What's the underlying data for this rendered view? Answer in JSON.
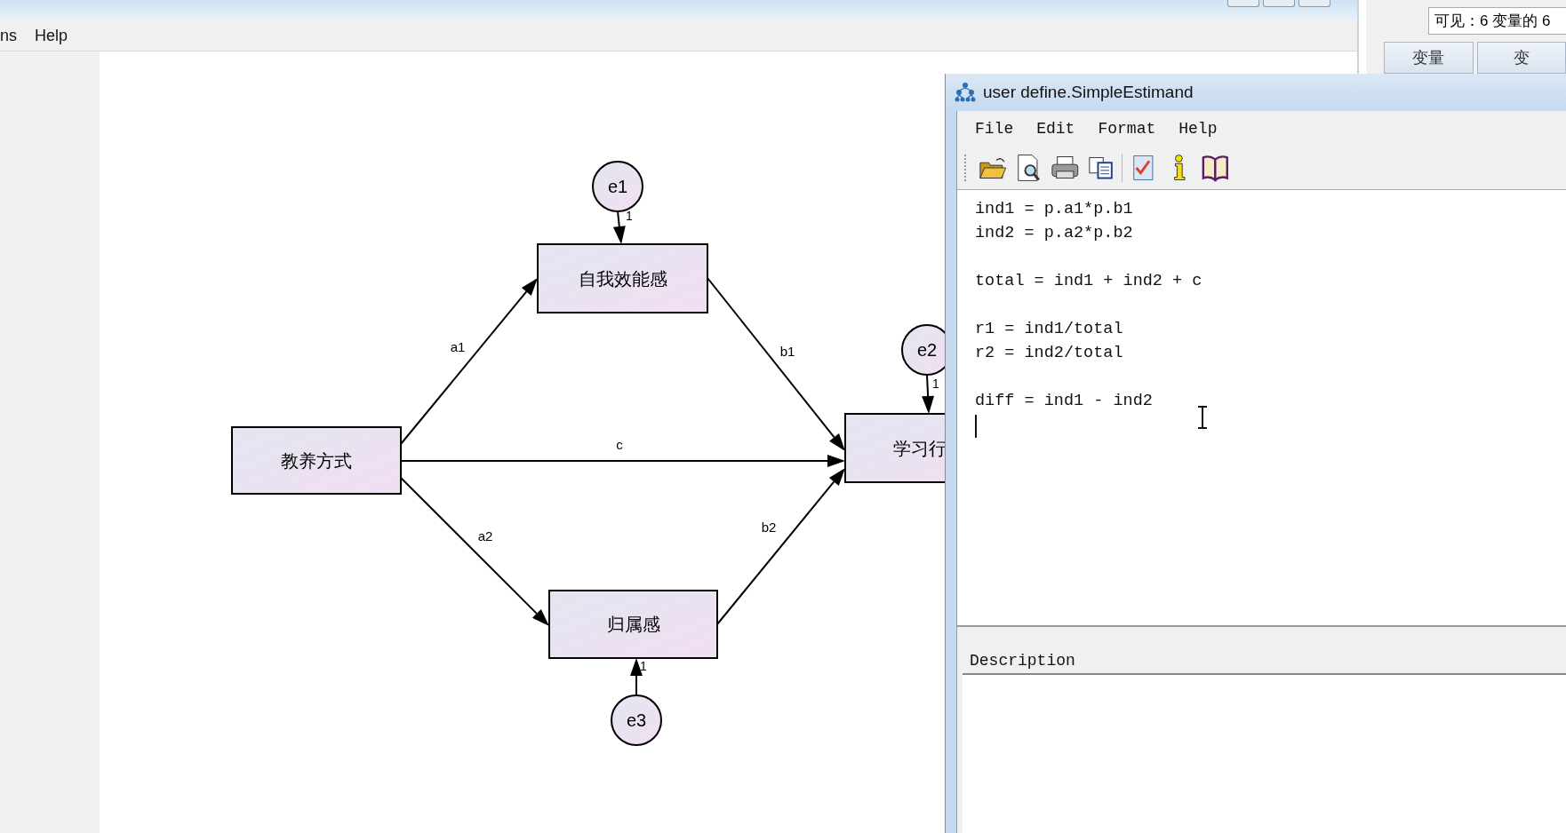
{
  "main_window": {
    "menu": [
      "ns",
      "Help"
    ]
  },
  "variable_panel": {
    "status": "可见：6 变量的 6",
    "tabs": [
      "变量",
      "变"
    ]
  },
  "diagram": {
    "nodes": [
      {
        "kind": "observed",
        "label": "教养方式"
      },
      {
        "kind": "observed",
        "label": "自我效能感"
      },
      {
        "kind": "observed",
        "label": "归属感"
      },
      {
        "kind": "observed",
        "label": "学习行"
      },
      {
        "kind": "error",
        "label": "e1"
      },
      {
        "kind": "error",
        "label": "e2"
      },
      {
        "kind": "error",
        "label": "e3"
      }
    ],
    "paths": [
      {
        "label": "a1"
      },
      {
        "label": "b1"
      },
      {
        "label": "c"
      },
      {
        "label": "a2"
      },
      {
        "label": "b2"
      },
      {
        "label": "1"
      },
      {
        "label": "1"
      },
      {
        "label": "1"
      }
    ]
  },
  "editor": {
    "title": "user define.SimpleEstimand",
    "menu": [
      "File",
      "Edit",
      "Format",
      "Help"
    ],
    "code": "ind1 = p.a1*p.b1\nind2 = p.a2*p.b2\n\ntotal = ind1 + ind2 + c\n\nr1 = ind1/total\nr2 = ind2/total\n\ndiff = ind1 - ind2",
    "description_label": "Description"
  }
}
